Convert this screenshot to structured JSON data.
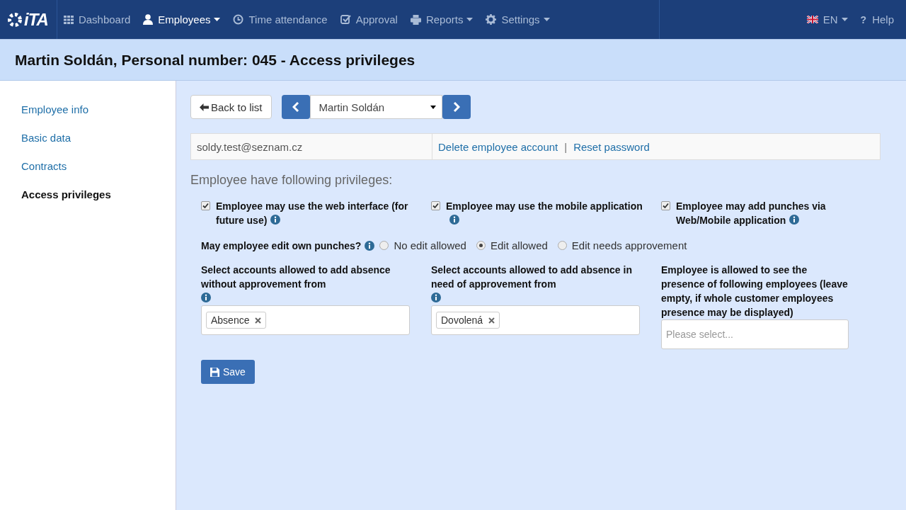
{
  "logo": {
    "text": "iTA"
  },
  "nav": [
    {
      "label": "Dashboard",
      "kind": "grid",
      "dropdown": false,
      "selected": false
    },
    {
      "label": "Employees",
      "kind": "user",
      "dropdown": true,
      "selected": true
    },
    {
      "label": "Time attendance",
      "kind": "clock",
      "dropdown": false,
      "selected": false
    },
    {
      "label": "Approval",
      "kind": "check",
      "dropdown": false,
      "selected": false
    },
    {
      "label": "Reports",
      "kind": "printer",
      "dropdown": true,
      "selected": false
    },
    {
      "label": "Settings",
      "kind": "gear",
      "dropdown": true,
      "selected": false
    }
  ],
  "language": {
    "label": "EN"
  },
  "help": {
    "icon": "?",
    "label": "Help"
  },
  "page_title": "Martin Soldán, Personal number: 045 - Access privileges",
  "sidebar": {
    "items": [
      {
        "label": "Employee info",
        "selected": false
      },
      {
        "label": "Basic data",
        "selected": false
      },
      {
        "label": "Contracts",
        "selected": false
      },
      {
        "label": "Access privileges",
        "selected": true
      }
    ]
  },
  "toolbar": {
    "back": "Back to list",
    "employee": "Martin Soldán"
  },
  "account": {
    "email": "soldy.test@seznam.cz",
    "links": [
      "Delete employee account",
      "Reset password"
    ],
    "separator": "|"
  },
  "privileges_heading": "Employee have following privileges:",
  "checkboxes": [
    {
      "label": "Employee may use the web interface (for future use)",
      "checked": true
    },
    {
      "label": "Employee may use the mobile application",
      "checked": true
    },
    {
      "label": "Employee may add punches via Web/Mobile application",
      "checked": true
    }
  ],
  "edit_punches": {
    "label": "May employee edit own punches?",
    "options": [
      {
        "label": "No edit allowed",
        "selected": false
      },
      {
        "label": "Edit allowed",
        "selected": true
      },
      {
        "label": "Edit needs approvement",
        "selected": false
      }
    ]
  },
  "selects": [
    {
      "label": "Select accounts allowed to add absence without approvement from",
      "info": true,
      "tags": [
        "Absence"
      ]
    },
    {
      "label": "Select accounts allowed to add absence in need of approvement from",
      "info": true,
      "tags": [
        "Dovolená"
      ]
    },
    {
      "label": "Employee is allowed to see the presence of following employees (leave empty, if whole customer employees presence may be displayed)",
      "info": false,
      "placeholder": "Please select..."
    }
  ],
  "save": "Save"
}
